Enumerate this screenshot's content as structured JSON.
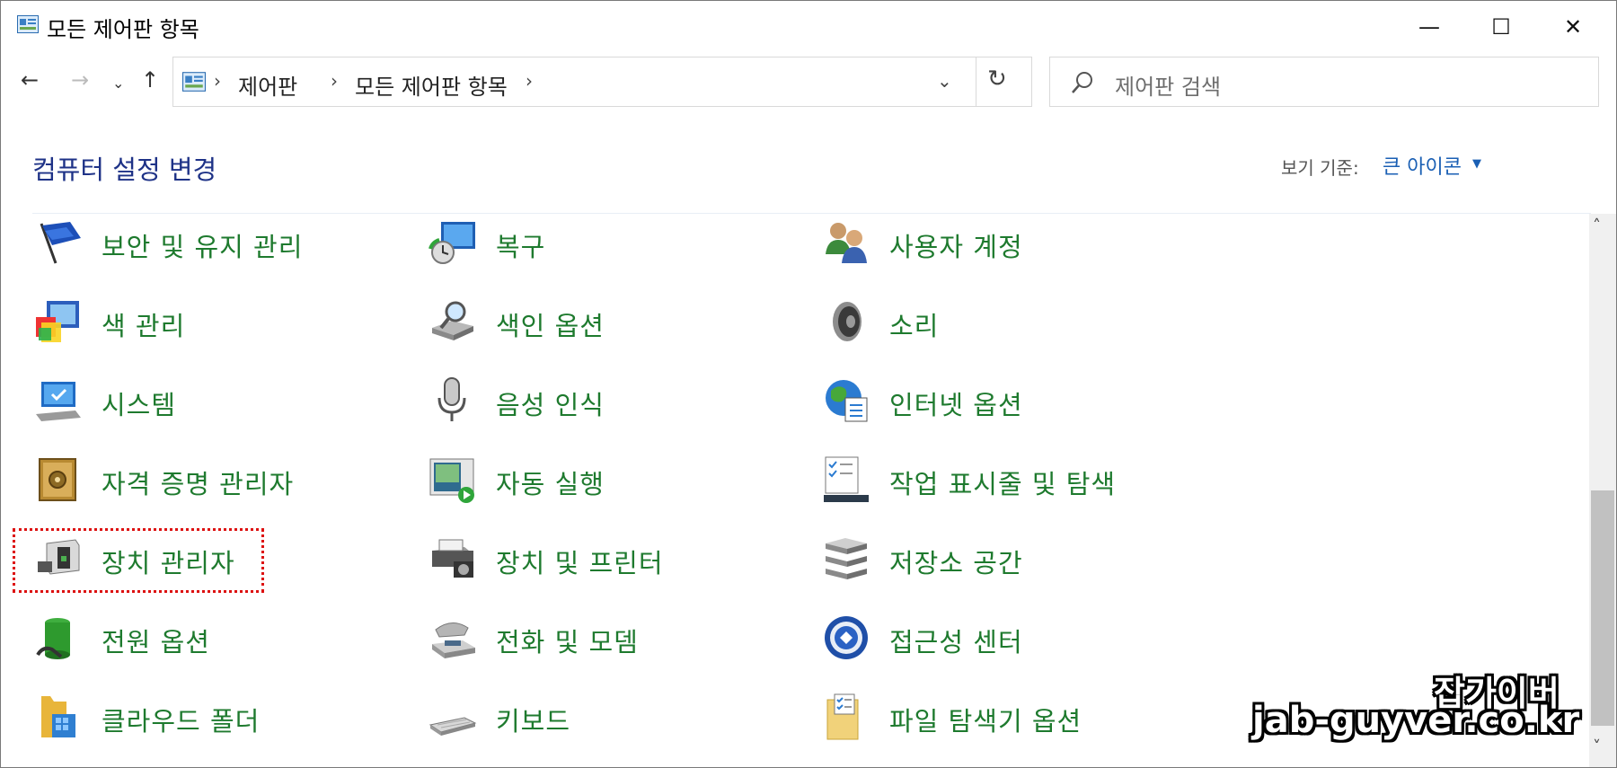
{
  "window": {
    "title": "모든 제어판 항목",
    "minimize_label": "—",
    "maximize_label": "☐",
    "close_label": "✕"
  },
  "nav": {
    "back": "←",
    "forward": "→",
    "recent": "⌄",
    "up": "↑",
    "breadcrumb": [
      "제어판",
      "모든 제어판 항목"
    ],
    "separator": "›",
    "dropdown": "⌄",
    "refresh": "↻"
  },
  "search": {
    "placeholder": "제어판 검색"
  },
  "header": {
    "title": "컴퓨터 설정 변경",
    "view_by_label": "보기 기준:",
    "view_by_value": "큰 아이콘",
    "view_caret": "▼"
  },
  "items": [
    {
      "label": "보안 및 유지 관리",
      "icon": "flag-icon"
    },
    {
      "label": "복구",
      "icon": "recovery-icon"
    },
    {
      "label": "사용자 계정",
      "icon": "users-icon"
    },
    {
      "label": "색 관리",
      "icon": "color-management-icon"
    },
    {
      "label": "색인 옵션",
      "icon": "indexing-icon"
    },
    {
      "label": "소리",
      "icon": "speaker-icon"
    },
    {
      "label": "시스템",
      "icon": "system-icon"
    },
    {
      "label": "음성 인식",
      "icon": "microphone-icon"
    },
    {
      "label": "인터넷 옵션",
      "icon": "globe-icon"
    },
    {
      "label": "자격 증명 관리자",
      "icon": "vault-icon"
    },
    {
      "label": "자동 실행",
      "icon": "autoplay-icon"
    },
    {
      "label": "작업 표시줄 및 탐색",
      "icon": "taskbar-icon"
    },
    {
      "label": "장치 관리자",
      "icon": "device-manager-icon"
    },
    {
      "label": "장치 및 프린터",
      "icon": "printer-icon"
    },
    {
      "label": "저장소 공간",
      "icon": "storage-icon"
    },
    {
      "label": "전원 옵션",
      "icon": "battery-icon"
    },
    {
      "label": "전화 및 모뎀",
      "icon": "phone-icon"
    },
    {
      "label": "접근성 센터",
      "icon": "accessibility-icon"
    },
    {
      "label": "클라우드 폴더",
      "icon": "cloud-folder-icon"
    },
    {
      "label": "키보드",
      "icon": "keyboard-icon"
    },
    {
      "label": "파일 탐색기 옵션",
      "icon": "folder-options-icon"
    }
  ],
  "scroll": {
    "up": "˄",
    "down": "˅"
  },
  "watermark": {
    "name": "잡가이버",
    "url": "jab-guyver.co.kr"
  },
  "colors": {
    "item_label": "#1e7a2e",
    "title": "#1e3287",
    "link": "#1a5fb4",
    "highlight": "#dd1111"
  }
}
